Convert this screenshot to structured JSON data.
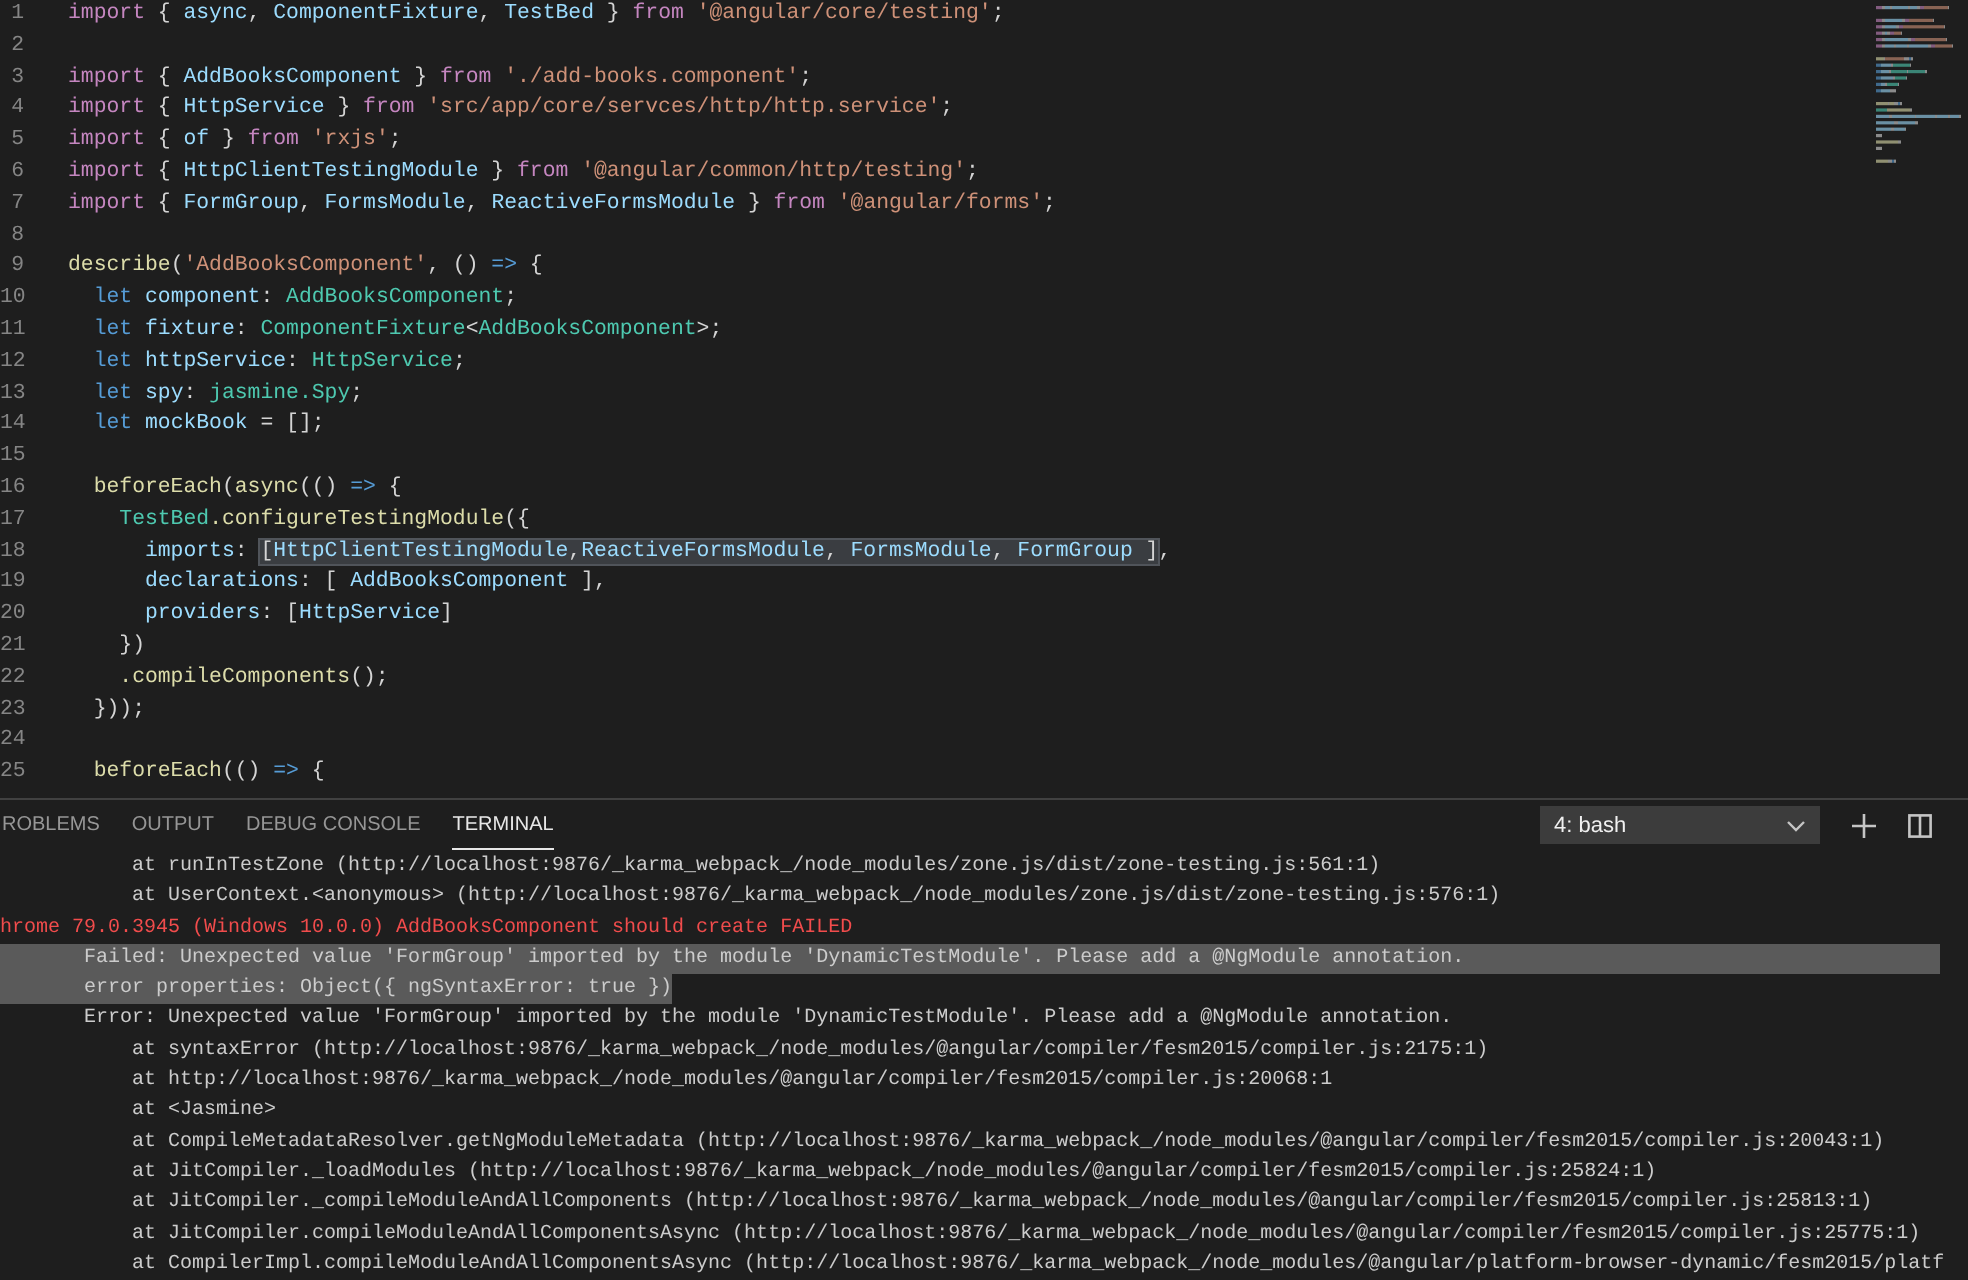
{
  "editor": {
    "lines": [
      {
        "number": "1",
        "tokens": [
          {
            "text": "import",
            "kind": "keyword"
          },
          {
            "text": " { ",
            "kind": "punct"
          },
          {
            "text": "async",
            "kind": "variable"
          },
          {
            "text": ", ",
            "kind": "punct"
          },
          {
            "text": "ComponentFixture",
            "kind": "variable"
          },
          {
            "text": ", ",
            "kind": "punct"
          },
          {
            "text": "TestBed",
            "kind": "variable"
          },
          {
            "text": " } ",
            "kind": "punct"
          },
          {
            "text": "from",
            "kind": "keyword"
          },
          {
            "text": " '@angular/core/testing'",
            "kind": "string"
          },
          {
            "text": ";",
            "kind": "punct"
          }
        ]
      },
      {
        "number": "2"
      },
      {
        "number": "3",
        "tokens": [
          {
            "text": "import",
            "kind": "keyword"
          },
          {
            "text": " { ",
            "kind": "punct"
          },
          {
            "text": "AddBooksComponent",
            "kind": "variable"
          },
          {
            "text": " } ",
            "kind": "punct"
          },
          {
            "text": "from",
            "kind": "keyword"
          },
          {
            "text": " './add-books.component'",
            "kind": "string"
          },
          {
            "text": ";",
            "kind": "punct"
          }
        ]
      },
      {
        "number": "4",
        "tokens": [
          {
            "text": "import",
            "kind": "keyword"
          },
          {
            "text": " { ",
            "kind": "punct"
          },
          {
            "text": "HttpService",
            "kind": "variable"
          },
          {
            "text": " } ",
            "kind": "punct"
          },
          {
            "text": "from",
            "kind": "keyword"
          },
          {
            "text": " 'src/app/core/servces/http/http.service'",
            "kind": "string"
          },
          {
            "text": ";",
            "kind": "punct"
          }
        ]
      },
      {
        "number": "5",
        "tokens": [
          {
            "text": "import",
            "kind": "keyword"
          },
          {
            "text": " { ",
            "kind": "punct"
          },
          {
            "text": "of",
            "kind": "variable"
          },
          {
            "text": " } ",
            "kind": "punct"
          },
          {
            "text": "from",
            "kind": "keyword"
          },
          {
            "text": " 'rxjs'",
            "kind": "string"
          },
          {
            "text": ";",
            "kind": "punct"
          }
        ]
      },
      {
        "number": "6",
        "tokens": [
          {
            "text": "import",
            "kind": "keyword"
          },
          {
            "text": " { ",
            "kind": "punct"
          },
          {
            "text": "HttpClientTestingModule",
            "kind": "variable"
          },
          {
            "text": " } ",
            "kind": "punct"
          },
          {
            "text": "from",
            "kind": "keyword"
          },
          {
            "text": " '@angular/common/http/testing'",
            "kind": "string"
          },
          {
            "text": ";",
            "kind": "punct"
          }
        ]
      },
      {
        "number": "7",
        "tokens": [
          {
            "text": "import",
            "kind": "keyword"
          },
          {
            "text": " { ",
            "kind": "punct"
          },
          {
            "text": "FormGroup",
            "kind": "variable"
          },
          {
            "text": ", ",
            "kind": "punct"
          },
          {
            "text": "FormsModule",
            "kind": "variable"
          },
          {
            "text": ", ",
            "kind": "punct"
          },
          {
            "text": "ReactiveFormsModule",
            "kind": "variable"
          },
          {
            "text": " } ",
            "kind": "punct"
          },
          {
            "text": "from",
            "kind": "keyword"
          },
          {
            "text": " '@angular/forms'",
            "kind": "string"
          },
          {
            "text": ";",
            "kind": "punct"
          }
        ]
      },
      {
        "number": "8"
      },
      {
        "number": "9",
        "tokens": [
          {
            "text": "describe",
            "kind": "function"
          },
          {
            "text": "(",
            "kind": "punct"
          },
          {
            "text": "'AddBooksComponent'",
            "kind": "string"
          },
          {
            "text": ", () ",
            "kind": "punct"
          },
          {
            "text": "=>",
            "kind": "storage"
          },
          {
            "text": " {",
            "kind": "punct"
          }
        ]
      },
      {
        "number": "10",
        "tokens": [
          {
            "text": "  let",
            "kind": "storage"
          },
          {
            "text": " component",
            "kind": "variable"
          },
          {
            "text": ": ",
            "kind": "punct"
          },
          {
            "text": "AddBooksComponent",
            "kind": "type"
          },
          {
            "text": ";",
            "kind": "punct"
          }
        ]
      },
      {
        "number": "11",
        "tokens": [
          {
            "text": "  let",
            "kind": "storage"
          },
          {
            "text": " fixture",
            "kind": "variable"
          },
          {
            "text": ": ",
            "kind": "punct"
          },
          {
            "text": "ComponentFixture",
            "kind": "type"
          },
          {
            "text": "<",
            "kind": "punct"
          },
          {
            "text": "AddBooksComponent",
            "kind": "type"
          },
          {
            "text": ">;",
            "kind": "punct"
          }
        ]
      },
      {
        "number": "12",
        "tokens": [
          {
            "text": "  let",
            "kind": "storage"
          },
          {
            "text": " httpService",
            "kind": "variable"
          },
          {
            "text": ": ",
            "kind": "punct"
          },
          {
            "text": "HttpService",
            "kind": "type"
          },
          {
            "text": ";",
            "kind": "punct"
          }
        ]
      },
      {
        "number": "13",
        "tokens": [
          {
            "text": "  let",
            "kind": "storage"
          },
          {
            "text": " spy",
            "kind": "variable"
          },
          {
            "text": ": ",
            "kind": "punct"
          },
          {
            "text": "jasmine.Spy",
            "kind": "type"
          },
          {
            "text": ";",
            "kind": "punct"
          }
        ]
      },
      {
        "number": "14",
        "tokens": [
          {
            "text": "  let",
            "kind": "storage"
          },
          {
            "text": " mockBook",
            "kind": "variable"
          },
          {
            "text": " = [];",
            "kind": "punct"
          }
        ]
      },
      {
        "number": "15"
      },
      {
        "number": "16",
        "tokens": [
          {
            "text": "  beforeEach",
            "kind": "function"
          },
          {
            "text": "(",
            "kind": "punct"
          },
          {
            "text": "async",
            "kind": "function"
          },
          {
            "text": "(() ",
            "kind": "punct"
          },
          {
            "text": "=>",
            "kind": "storage"
          },
          {
            "text": " {",
            "kind": "punct"
          }
        ]
      },
      {
        "number": "17",
        "tokens": [
          {
            "text": "    TestBed",
            "kind": "type"
          },
          {
            "text": ".configureTestingModule",
            "kind": "function"
          },
          {
            "text": "({",
            "kind": "punct"
          }
        ]
      },
      {
        "number": "18",
        "tokens": [
          {
            "text": "      imports",
            "kind": "variable"
          },
          {
            "text": ": ",
            "kind": "punct"
          }
        ],
        "selection": [
          {
            "text": "[",
            "kind": "punct"
          },
          {
            "text": "HttpClientTestingModule",
            "kind": "variable"
          },
          {
            "text": ",",
            "kind": "punct"
          },
          {
            "text": "ReactiveFormsModule",
            "kind": "variable"
          },
          {
            "text": ", ",
            "kind": "punct"
          },
          {
            "text": "FormsModule",
            "kind": "variable"
          },
          {
            "text": ", ",
            "kind": "punct"
          },
          {
            "text": "FormGroup",
            "kind": "variable"
          },
          {
            "text": " ]",
            "kind": "punct"
          }
        ],
        "after_text": ","
      },
      {
        "number": "19",
        "tokens": [
          {
            "text": "      declarations",
            "kind": "variable"
          },
          {
            "text": ": [ ",
            "kind": "punct"
          },
          {
            "text": "AddBooksComponent",
            "kind": "variable"
          },
          {
            "text": " ],",
            "kind": "punct"
          }
        ]
      },
      {
        "number": "20",
        "tokens": [
          {
            "text": "      providers",
            "kind": "variable"
          },
          {
            "text": ": [",
            "kind": "punct"
          },
          {
            "text": "HttpService",
            "kind": "variable"
          },
          {
            "text": "]",
            "kind": "punct"
          }
        ]
      },
      {
        "number": "21",
        "tokens": [
          {
            "text": "    })",
            "kind": "punct"
          }
        ]
      },
      {
        "number": "22",
        "tokens": [
          {
            "text": "    .compileComponents",
            "kind": "function"
          },
          {
            "text": "();",
            "kind": "punct"
          }
        ]
      },
      {
        "number": "23",
        "tokens": [
          {
            "text": "  }));",
            "kind": "punct"
          }
        ]
      },
      {
        "number": "24"
      },
      {
        "number": "25",
        "tokens": [
          {
            "text": "  beforeEach",
            "kind": "function"
          },
          {
            "text": "(() ",
            "kind": "punct"
          },
          {
            "text": "=>",
            "kind": "storage"
          },
          {
            "text": " {",
            "kind": "punct"
          }
        ]
      }
    ]
  },
  "panel": {
    "tabs": [
      {
        "label": "ROBLEMS",
        "selected": false
      },
      {
        "label": "OUTPUT",
        "selected": false
      },
      {
        "label": "DEBUG CONSOLE",
        "selected": false
      },
      {
        "label": "TERMINAL",
        "selected": true
      }
    ],
    "terminal_select": {
      "value": "4: bash"
    },
    "terminal": {
      "lines": [
        {
          "text": "           at runInTestZone (http://localhost:9876/_karma_webpack_/node_modules/zone.js/dist/zone-testing.js:561:1)",
          "kind": "normal",
          "selected": false
        },
        {
          "text": "           at UserContext.<anonymous> (http://localhost:9876/_karma_webpack_/node_modules/zone.js/dist/zone-testing.js:576:1)",
          "kind": "normal",
          "selected": false
        },
        {
          "text": "hrome 79.0.3945 (Windows 10.0.0) AddBooksComponent should create FAILED",
          "kind": "error",
          "selected": false
        },
        {
          "text": "       Failed: Unexpected value 'FormGroup' imported by the module 'DynamicTestModule'. Please add a @NgModule annotation.",
          "kind": "normal",
          "selected": true
        },
        {
          "text": "       error properties: Object({ ngSyntaxError: true })",
          "kind": "normal",
          "selected": true
        },
        {
          "text": "       Error: Unexpected value 'FormGroup' imported by the module 'DynamicTestModule'. Please add a @NgModule annotation.",
          "kind": "normal",
          "selected": false
        },
        {
          "text": "           at syntaxError (http://localhost:9876/_karma_webpack_/node_modules/@angular/compiler/fesm2015/compiler.js:2175:1)",
          "kind": "normal",
          "selected": false
        },
        {
          "text": "           at http://localhost:9876/_karma_webpack_/node_modules/@angular/compiler/fesm2015/compiler.js:20068:1",
          "kind": "normal",
          "selected": false
        },
        {
          "text": "           at <Jasmine>",
          "kind": "normal",
          "selected": false
        },
        {
          "text": "           at CompileMetadataResolver.getNgModuleMetadata (http://localhost:9876/_karma_webpack_/node_modules/@angular/compiler/fesm2015/compiler.js:20043:1)",
          "kind": "normal",
          "selected": false
        },
        {
          "text": "           at JitCompiler._loadModules (http://localhost:9876/_karma_webpack_/node_modules/@angular/compiler/fesm2015/compiler.js:25824:1)",
          "kind": "normal",
          "selected": false
        },
        {
          "text": "           at JitCompiler._compileModuleAndAllComponents (http://localhost:9876/_karma_webpack_/node_modules/@angular/compiler/fesm2015/compiler.js:25813:1)",
          "kind": "normal",
          "selected": false
        },
        {
          "text": "           at JitCompiler.compileModuleAndAllComponentsAsync (http://localhost:9876/_karma_webpack_/node_modules/@angular/compiler/fesm2015/compiler.js:25775:1)",
          "kind": "normal",
          "selected": false
        },
        {
          "text": "           at CompilerImpl.compileModuleAndAllComponentsAsync (http://localhost:9876/_karma_webpack_/node_modules/@angular/platform-browser-dynamic/fesm2015/platf",
          "kind": "normal",
          "selected": false
        }
      ]
    }
  }
}
